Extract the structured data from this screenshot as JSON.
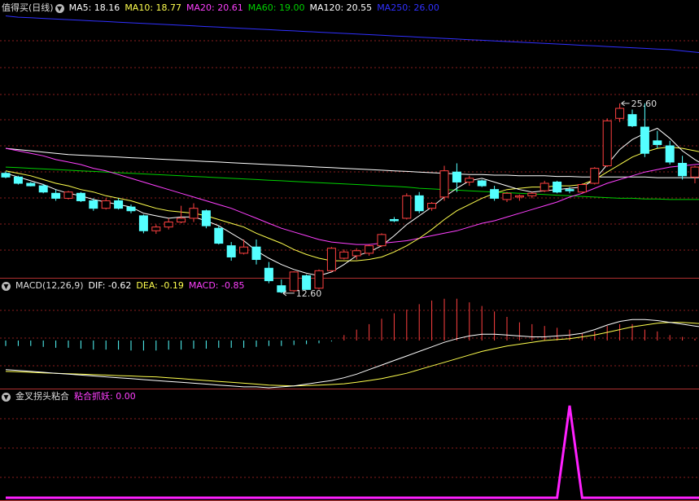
{
  "colors": {
    "up": "#ff4040",
    "down": "#54ffff",
    "ma5": "#ffffff",
    "ma10": "#ffff4e",
    "ma20": "#ff40ff",
    "ma60": "#00d000",
    "ma120": "#ffffff",
    "ma250": "#3030ff",
    "dif": "#ffffff",
    "dea": "#ffff4e",
    "macd": "#ff40ff",
    "signal": "#ff20ff",
    "grid": "#8a1e1e",
    "hist_up": "#ff4040",
    "hist_down": "#54ffff"
  },
  "icons": {
    "menu": "chevron-down-icon"
  },
  "price_panel": {
    "title": "值得买(日线)",
    "ma5": "MA5: 18.16",
    "ma10": "MA10: 18.77",
    "ma20": "MA20: 20.61",
    "ma60": "MA60: 19.00",
    "ma120": "MA120: 20.55",
    "ma250": "MA250: 26.00",
    "low_label": "12.60",
    "high_label": "25.60"
  },
  "macd_panel": {
    "title": "MACD(12,26,9)",
    "dif": "DIF: -0.62",
    "dea": "DEA: -0.19",
    "macd": "MACD: -0.85"
  },
  "signal_panel": {
    "title": "金叉拐头粘合",
    "value": "粘合抓妖: 0.00"
  },
  "chart_data": [
    {
      "type": "candlestick",
      "ylim": [
        9.5,
        30.5
      ],
      "candles": [
        [
          17.8,
          17.95,
          17.4,
          17.5
        ],
        [
          17.5,
          17.6,
          16.9,
          17.0
        ],
        [
          17.0,
          17.1,
          16.75,
          16.8
        ],
        [
          16.8,
          16.95,
          16.2,
          16.3
        ],
        [
          16.2,
          16.5,
          15.6,
          15.8
        ],
        [
          15.8,
          16.4,
          15.7,
          16.3
        ],
        [
          16.2,
          16.3,
          15.5,
          15.6
        ],
        [
          15.6,
          15.8,
          14.8,
          15.0
        ],
        [
          15.0,
          15.8,
          14.9,
          15.6
        ],
        [
          15.6,
          15.8,
          14.9,
          15.0
        ],
        [
          15.1,
          15.3,
          14.6,
          14.8
        ],
        [
          14.4,
          14.5,
          13.0,
          13.2
        ],
        [
          13.2,
          13.7,
          12.95,
          13.5
        ],
        [
          13.5,
          14.2,
          13.3,
          13.9
        ],
        [
          13.9,
          15.2,
          13.8,
          14.2
        ],
        [
          14.2,
          15.4,
          13.9,
          15.0
        ],
        [
          14.8,
          14.9,
          13.4,
          13.6
        ],
        [
          13.4,
          13.6,
          12.1,
          12.2
        ],
        [
          12.0,
          12.3,
          10.8,
          11.1
        ],
        [
          11.4,
          12.5,
          11.3,
          11.9
        ],
        [
          11.9,
          12.5,
          10.5,
          10.9
        ],
        [
          10.2,
          10.7,
          9.0,
          9.2
        ],
        [
          8.8,
          9.3,
          8.2,
          8.3
        ],
        [
          8.4,
          9.95,
          8.3,
          9.9
        ],
        [
          9.6,
          9.7,
          8.5,
          8.5
        ],
        [
          8.6,
          10.1,
          8.5,
          10.0
        ],
        [
          10.0,
          11.9,
          9.9,
          11.8
        ],
        [
          11.0,
          11.7,
          10.9,
          11.5
        ],
        [
          11.2,
          11.8,
          10.9,
          11.6
        ],
        [
          11.4,
          12.1,
          11.2,
          12.0
        ],
        [
          12.0,
          13.0,
          11.9,
          12.9
        ],
        [
          14.1,
          14.3,
          13.9,
          14.0
        ],
        [
          14.2,
          16.2,
          14.1,
          16.0
        ],
        [
          16.0,
          16.3,
          14.6,
          14.8
        ],
        [
          15.0,
          15.5,
          14.8,
          15.4
        ],
        [
          15.9,
          18.4,
          15.6,
          18.0
        ],
        [
          17.9,
          18.6,
          16.3,
          17.1
        ],
        [
          17.1,
          17.6,
          16.8,
          17.4
        ],
        [
          17.2,
          17.3,
          16.7,
          16.8
        ],
        [
          16.5,
          16.8,
          15.6,
          15.8
        ],
        [
          15.7,
          16.3,
          15.5,
          16.2
        ],
        [
          15.9,
          16.1,
          15.6,
          16.0
        ],
        [
          16.0,
          16.3,
          15.8,
          16.2
        ],
        [
          16.4,
          17.2,
          16.3,
          17.0
        ],
        [
          17.1,
          17.2,
          16.2,
          16.3
        ],
        [
          16.5,
          16.7,
          16.2,
          16.4
        ],
        [
          16.3,
          17.0,
          16.2,
          16.9
        ],
        [
          17.0,
          18.3,
          16.9,
          18.2
        ],
        [
          18.4,
          22.2,
          18.3,
          22.0
        ],
        [
          22.2,
          23.4,
          21.9,
          23.0
        ],
        [
          22.5,
          22.9,
          21.5,
          21.6
        ],
        [
          21.5,
          23.4,
          19.1,
          19.4
        ],
        [
          20.4,
          21.2,
          19.8,
          20.1
        ],
        [
          20.0,
          20.4,
          18.5,
          18.7
        ],
        [
          18.6,
          19.2,
          17.3,
          17.6
        ],
        [
          17.5,
          18.4,
          17.0,
          18.3
        ],
        [
          18.0,
          18.1,
          17.5,
          17.6
        ],
        [
          17.6,
          18.4,
          17.5,
          18.3
        ]
      ],
      "ma5": [
        17.8,
        17.5,
        17.2,
        16.9,
        16.5,
        16.2,
        16.0,
        15.7,
        15.5,
        15.3,
        15.1,
        14.6,
        14.4,
        14.2,
        14.3,
        14.3,
        14.0,
        13.6,
        13.0,
        12.4,
        11.6,
        11.0,
        10.5,
        10.1,
        9.8,
        9.6,
        9.9,
        10.5,
        11.2,
        11.5,
        12.0,
        12.8,
        13.7,
        14.4,
        15.1,
        15.9,
        16.6,
        17.2,
        17.4,
        17.1,
        16.8,
        16.5,
        16.3,
        16.4,
        16.5,
        16.6,
        16.7,
        17.3,
        18.5,
        19.7,
        20.5,
        21.0,
        21.4,
        20.6,
        19.6,
        18.9,
        18.3,
        18.0
      ],
      "ma10": [
        18.0,
        17.8,
        17.6,
        17.3,
        17.0,
        16.8,
        16.5,
        16.3,
        16.0,
        15.8,
        15.6,
        15.3,
        15.0,
        14.8,
        14.7,
        14.6,
        14.4,
        14.1,
        13.8,
        13.5,
        13.0,
        12.6,
        12.2,
        11.7,
        11.3,
        11.0,
        10.8,
        10.8,
        10.8,
        10.9,
        11.1,
        11.5,
        12.0,
        12.6,
        13.3,
        14.1,
        14.8,
        15.3,
        15.8,
        16.2,
        16.5,
        16.6,
        16.7,
        16.7,
        16.8,
        16.8,
        16.9,
        17.3,
        17.9,
        18.5,
        19.1,
        19.5,
        19.8,
        19.9,
        19.8,
        19.6,
        19.4,
        19.3
      ],
      "ma20": [
        19.8,
        19.6,
        19.4,
        19.2,
        18.9,
        18.7,
        18.5,
        18.2,
        18.0,
        17.7,
        17.4,
        17.1,
        16.8,
        16.5,
        16.2,
        15.9,
        15.6,
        15.3,
        15.0,
        14.6,
        14.2,
        13.8,
        13.4,
        13.1,
        12.8,
        12.5,
        12.3,
        12.2,
        12.1,
        12.1,
        12.2,
        12.3,
        12.4,
        12.6,
        12.8,
        13.0,
        13.2,
        13.5,
        13.8,
        14.0,
        14.3,
        14.6,
        14.9,
        15.2,
        15.5,
        15.9,
        16.2,
        16.6,
        17.0,
        17.3,
        17.6,
        17.9,
        18.1,
        18.3,
        18.4,
        18.5,
        18.6,
        18.6
      ],
      "ma60": [
        18.3,
        18.25,
        18.2,
        18.15,
        18.1,
        18.05,
        18.0,
        17.95,
        17.9,
        17.85,
        17.8,
        17.75,
        17.7,
        17.65,
        17.6,
        17.55,
        17.5,
        17.45,
        17.4,
        17.35,
        17.3,
        17.25,
        17.2,
        17.15,
        17.1,
        17.05,
        17.0,
        16.95,
        16.9,
        16.85,
        16.8,
        16.75,
        16.7,
        16.6,
        16.55,
        16.5,
        16.45,
        16.4,
        16.35,
        16.3,
        16.25,
        16.2,
        16.15,
        16.1,
        16.05,
        16.0,
        15.95,
        15.9,
        15.85,
        15.8,
        15.8,
        15.75,
        15.75,
        15.7,
        15.7,
        15.7,
        15.7,
        15.7
      ],
      "ma120": [
        19.8,
        19.7,
        19.6,
        19.5,
        19.4,
        19.3,
        19.25,
        19.2,
        19.15,
        19.1,
        19.05,
        19.0,
        18.95,
        18.9,
        18.85,
        18.8,
        18.75,
        18.7,
        18.65,
        18.6,
        18.55,
        18.5,
        18.45,
        18.4,
        18.35,
        18.3,
        18.25,
        18.2,
        18.15,
        18.1,
        18.05,
        18.0,
        17.95,
        17.9,
        17.85,
        17.8,
        17.75,
        17.7,
        17.7,
        17.65,
        17.65,
        17.6,
        17.6,
        17.6,
        17.55,
        17.55,
        17.5,
        17.5,
        17.5,
        17.5,
        17.5,
        17.5,
        17.45,
        17.45,
        17.45,
        17.45,
        17.45,
        17.45
      ],
      "ma250": [
        30.4,
        30.3,
        30.25,
        30.2,
        30.15,
        30.1,
        30.05,
        30.0,
        29.95,
        29.9,
        29.85,
        29.8,
        29.75,
        29.7,
        29.65,
        29.6,
        29.55,
        29.5,
        29.45,
        29.4,
        29.35,
        29.3,
        29.25,
        29.2,
        29.15,
        29.1,
        29.05,
        29.0,
        28.95,
        28.9,
        28.85,
        28.8,
        28.75,
        28.7,
        28.65,
        28.6,
        28.55,
        28.5,
        28.45,
        28.4,
        28.35,
        28.3,
        28.25,
        28.2,
        28.15,
        28.1,
        28.05,
        28.0,
        27.95,
        27.9,
        27.85,
        27.8,
        27.75,
        27.7,
        27.6,
        27.5,
        27.4,
        27.3
      ]
    },
    {
      "type": "line+bar",
      "ylim": [
        -2.6,
        2.6
      ],
      "dif": [
        -1.6,
        -1.65,
        -1.7,
        -1.75,
        -1.8,
        -1.85,
        -1.9,
        -1.95,
        -2.0,
        -2.05,
        -2.1,
        -2.15,
        -2.2,
        -2.25,
        -2.3,
        -2.35,
        -2.4,
        -2.45,
        -2.5,
        -2.55,
        -2.55,
        -2.6,
        -2.55,
        -2.5,
        -2.4,
        -2.3,
        -2.2,
        -2.05,
        -1.85,
        -1.6,
        -1.35,
        -1.1,
        -0.85,
        -0.6,
        -0.35,
        -0.1,
        0.1,
        0.25,
        0.35,
        0.35,
        0.3,
        0.25,
        0.2,
        0.2,
        0.25,
        0.3,
        0.4,
        0.6,
        0.85,
        1.05,
        1.15,
        1.15,
        1.1,
        1.0,
        0.9,
        0.8,
        0.7,
        0.62
      ],
      "dea": [
        -1.7,
        -1.72,
        -1.75,
        -1.78,
        -1.8,
        -1.83,
        -1.85,
        -1.88,
        -1.9,
        -1.93,
        -1.95,
        -1.98,
        -2.0,
        -2.05,
        -2.1,
        -2.15,
        -2.2,
        -2.25,
        -2.3,
        -2.35,
        -2.4,
        -2.45,
        -2.48,
        -2.5,
        -2.48,
        -2.45,
        -2.42,
        -2.38,
        -2.3,
        -2.2,
        -2.1,
        -1.95,
        -1.8,
        -1.6,
        -1.4,
        -1.2,
        -1.0,
        -0.8,
        -0.6,
        -0.45,
        -0.3,
        -0.2,
        -0.1,
        0.0,
        0.05,
        0.1,
        0.2,
        0.3,
        0.45,
        0.6,
        0.75,
        0.85,
        0.95,
        1.0,
        1.0,
        0.95,
        0.9,
        0.85
      ],
      "macd": [
        -0.3,
        -0.3,
        -0.3,
        -0.35,
        -0.4,
        -0.4,
        -0.45,
        -0.5,
        -0.5,
        -0.5,
        -0.55,
        -0.55,
        -0.55,
        -0.5,
        -0.5,
        -0.45,
        -0.45,
        -0.4,
        -0.4,
        -0.4,
        -0.35,
        -0.3,
        -0.3,
        -0.25,
        -0.2,
        -0.15,
        -0.05,
        0.3,
        0.6,
        0.9,
        1.2,
        1.5,
        1.7,
        2.0,
        2.2,
        2.3,
        2.3,
        2.1,
        1.9,
        1.6,
        1.3,
        1.0,
        0.9,
        0.8,
        0.7,
        0.6,
        0.4,
        0.5,
        0.8,
        0.9,
        0.9,
        0.6,
        0.5,
        0.3,
        0.2,
        0.1,
        -0.05,
        -0.2
      ]
    },
    {
      "type": "line",
      "ylim": [
        0,
        100
      ],
      "values": [
        0,
        0,
        0,
        0,
        0,
        0,
        0,
        0,
        0,
        0,
        0,
        0,
        0,
        0,
        0,
        0,
        0,
        0,
        0,
        0,
        0,
        0,
        0,
        0,
        0,
        0,
        0,
        0,
        0,
        0,
        0,
        0,
        0,
        0,
        0,
        0,
        0,
        0,
        0,
        0,
        0,
        0,
        0,
        0,
        0,
        100,
        0,
        0,
        0,
        0,
        0,
        0,
        0,
        0,
        0,
        0,
        0,
        0
      ]
    }
  ]
}
